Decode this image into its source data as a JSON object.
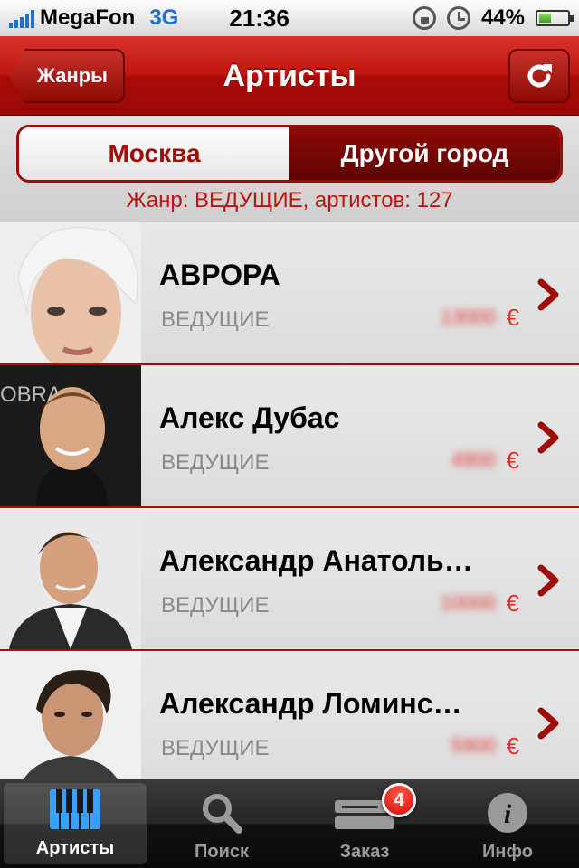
{
  "status_bar": {
    "carrier": "MegaFon",
    "network": "3G",
    "time": "21:36",
    "battery": "44%",
    "battery_level": 0.44
  },
  "nav": {
    "back_label": "Жанры",
    "title": "Артисты",
    "refresh_icon": "refresh-icon"
  },
  "filter": {
    "segments": [
      "Москва",
      "Другой город"
    ],
    "selected": "Москва",
    "genre_info": "Жанр: ВЕДУЩИЕ, артистов: 127"
  },
  "artists": [
    {
      "name": "АВРОРА",
      "genre": "ВЕДУЩИЕ",
      "price": "13000",
      "currency": "€"
    },
    {
      "name": "Алекс Дубас",
      "genre": "ВЕДУЩИЕ",
      "price": "4900",
      "currency": "€"
    },
    {
      "name": "Александр Анатоль…",
      "genre": "ВЕДУЩИЕ",
      "price": "10000",
      "currency": "€"
    },
    {
      "name": "Александр Ломинс…",
      "genre": "ВЕДУЩИЕ",
      "price": "5900",
      "currency": "€"
    }
  ],
  "tabs": [
    {
      "label": "Артисты",
      "icon": "piano-keys-icon",
      "selected": true
    },
    {
      "label": "Поиск",
      "icon": "search-icon",
      "selected": false
    },
    {
      "label": "Заказ",
      "icon": "order-icon",
      "selected": false,
      "badge": "4"
    },
    {
      "label": "Инфо",
      "icon": "info-icon",
      "selected": false
    }
  ],
  "colors": {
    "accent_red": "#c01710",
    "selected_text": "#a30c06",
    "price_red": "#e3322b",
    "network_blue": "#1e6fd6"
  }
}
